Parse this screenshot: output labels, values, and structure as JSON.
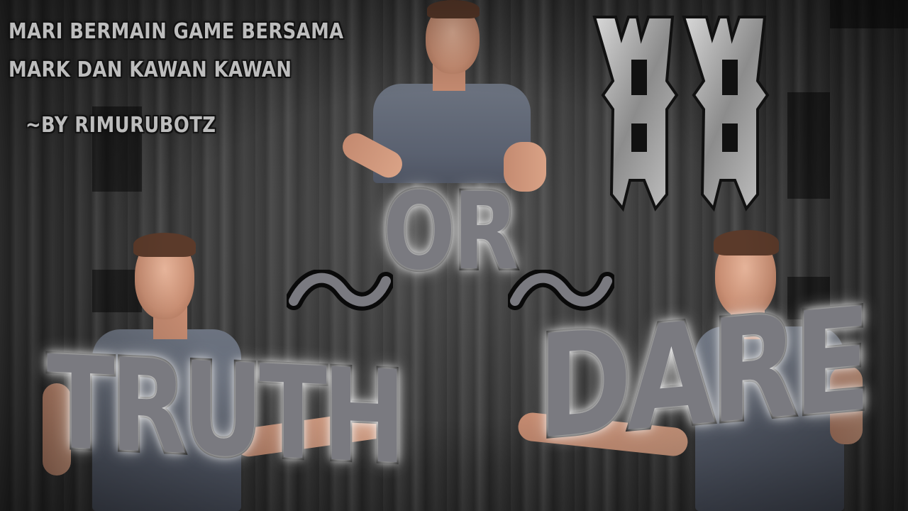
{
  "caption": {
    "line1": "MARI BERMAIN GAME BERSAMA",
    "line2": "MARK DAN KAWAN KAWAN",
    "byline": "~BY RIMURUBOTZ"
  },
  "words": {
    "truth": "TRUTH",
    "or": "OR",
    "dare": "DARE"
  },
  "logo": {
    "icon": "aa-logo-icon"
  },
  "colors": {
    "text_fill": "#7a7a80",
    "text_stroke": "#0a0a0a",
    "caption": "#bdbdbd",
    "shirt": "#5a6170"
  }
}
